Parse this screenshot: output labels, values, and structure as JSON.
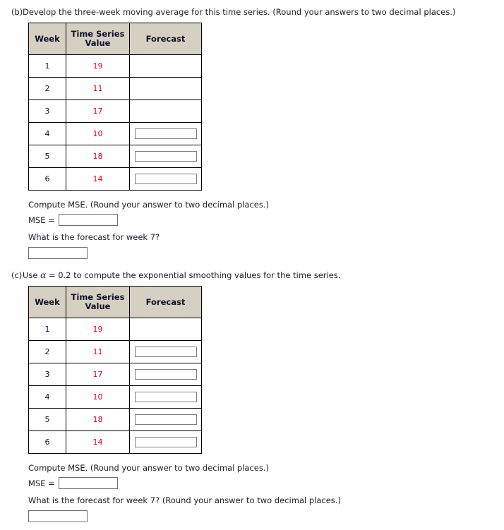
{
  "parts": {
    "b": {
      "label": "(b)",
      "prompt": "Develop the three-week moving average for this time series. (Round your answers to two decimal places.)",
      "table": {
        "headers": [
          "Week",
          "Time Series Value",
          "Forecast"
        ],
        "header_week": "Week",
        "header_value_line1": "Time Series",
        "header_value_line2": "Value",
        "header_forecast": "Forecast",
        "rows": [
          {
            "week": "1",
            "value": "19",
            "forecast_input": false
          },
          {
            "week": "2",
            "value": "11",
            "forecast_input": false
          },
          {
            "week": "3",
            "value": "17",
            "forecast_input": false
          },
          {
            "week": "4",
            "value": "10",
            "forecast_input": true
          },
          {
            "week": "5",
            "value": "18",
            "forecast_input": true
          },
          {
            "week": "6",
            "value": "14",
            "forecast_input": true
          }
        ]
      },
      "mse_prompt": "Compute MSE. (Round your answer to two decimal places.)",
      "mse_label": "MSE =",
      "mse_value": "",
      "forecast_prompt": "What is the forecast for week 7?",
      "forecast_value": ""
    },
    "c": {
      "label": "(c)",
      "prompt_before_alpha": "Use ",
      "alpha_symbol": "α",
      "prompt_after_alpha": " = 0.2 to compute the exponential smoothing values for the time series.",
      "alpha_value": "0.2",
      "table": {
        "headers": [
          "Week",
          "Time Series Value",
          "Forecast"
        ],
        "header_week": "Week",
        "header_value_line1": "Time Series",
        "header_value_line2": "Value",
        "header_forecast": "Forecast",
        "rows": [
          {
            "week": "1",
            "value": "19",
            "forecast_input": false
          },
          {
            "week": "2",
            "value": "11",
            "forecast_input": true
          },
          {
            "week": "3",
            "value": "17",
            "forecast_input": true
          },
          {
            "week": "4",
            "value": "10",
            "forecast_input": true
          },
          {
            "week": "5",
            "value": "18",
            "forecast_input": true
          },
          {
            "week": "6",
            "value": "14",
            "forecast_input": true
          }
        ]
      },
      "mse_prompt": "Compute MSE. (Round your answer to two decimal places.)",
      "mse_label": "MSE =",
      "mse_value": "",
      "forecast_prompt": "What is the forecast for week 7? (Round your answer to two decimal places.)",
      "forecast_value": ""
    }
  },
  "colors": {
    "header_bg": "#d5d0c1",
    "value_red": "#e8000d",
    "text": "#1a1a2e",
    "input_border": "#7d7d7d",
    "table_border": "#000000"
  }
}
